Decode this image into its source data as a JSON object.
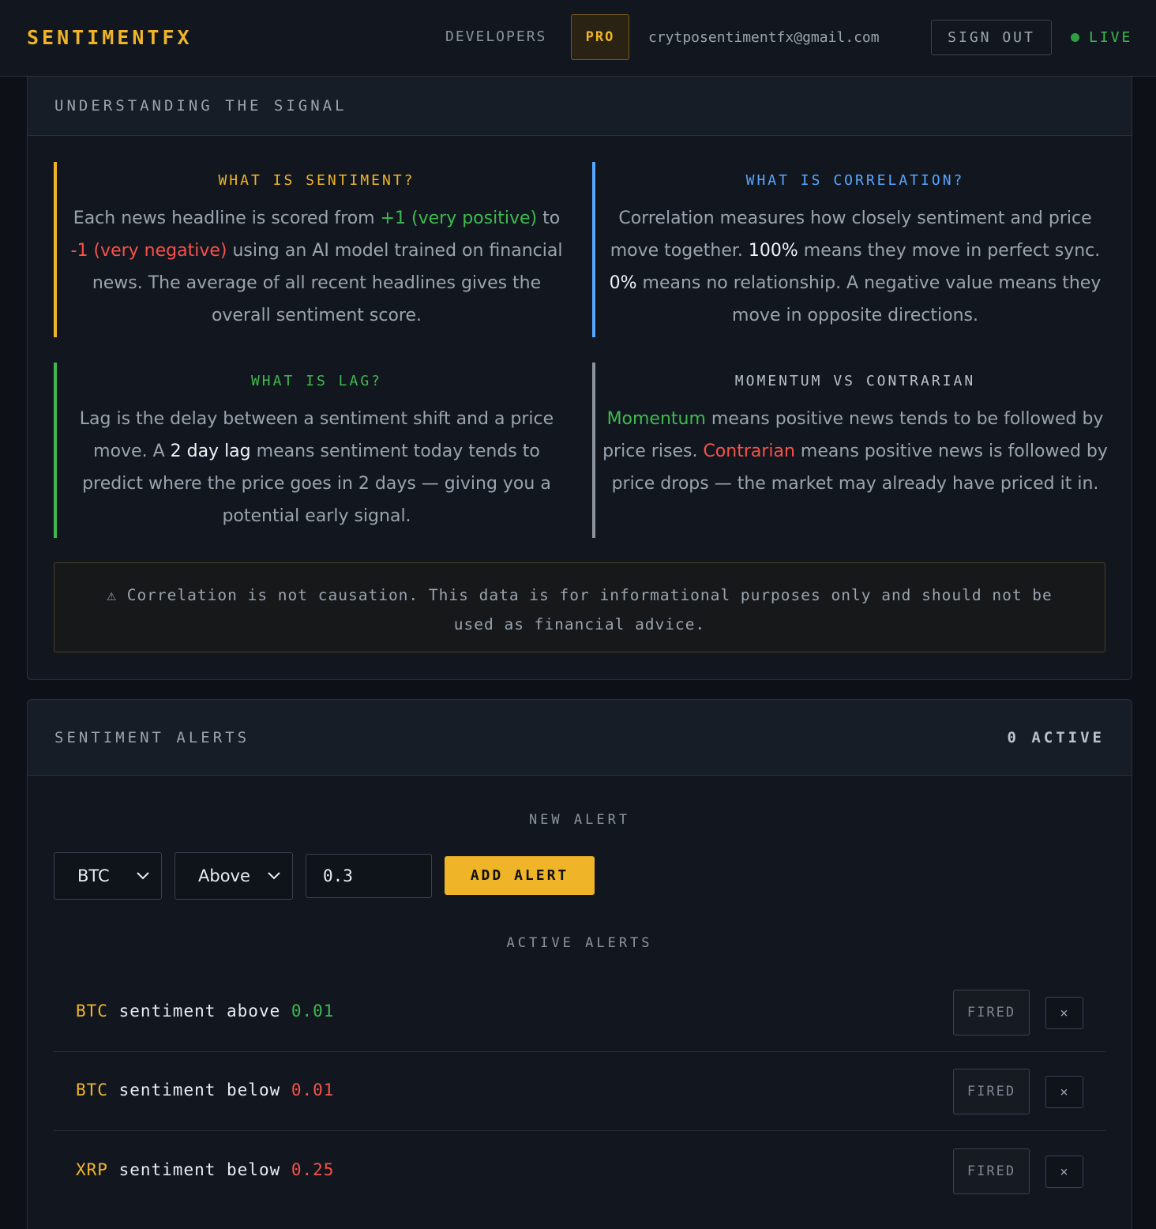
{
  "header": {
    "brand": "SENTIMENTFX",
    "developers": "DEVELOPERS",
    "pro": "PRO",
    "email": "crytposentimentfx@gmail.com",
    "sign_out": "SIGN OUT",
    "live": "LIVE",
    "live_color": "#3fb950"
  },
  "signal": {
    "title": "UNDERSTANDING THE SIGNAL",
    "sentiment": {
      "heading": "WHAT IS SENTIMENT?",
      "t1": "Each news headline is scored from ",
      "pos": "+1 (very positive)",
      "t2": " to ",
      "neg": "-1 (very negative)",
      "t3": " using an AI model trained on financial news. The average of all recent headlines gives the overall sentiment score.",
      "accent": "#f0b429"
    },
    "correlation": {
      "heading": "WHAT IS CORRELATION?",
      "t1": "Correlation measures how closely sentiment and price move together. ",
      "v1": "100%",
      "t2": " means they move in perfect sync. ",
      "v2": "0%",
      "t3": " means no relationship. A negative value means they move in opposite directions.",
      "accent": "#58a6ff"
    },
    "lag": {
      "heading": "WHAT IS LAG?",
      "t1": "Lag is the delay between a sentiment shift and a price move. A ",
      "v1": "2 day lag",
      "t2": " means sentiment today tends to predict where the price goes in 2 days — giving you a potential early signal.",
      "accent": "#3fb950"
    },
    "momentum": {
      "heading": "MOMENTUM VS CONTRARIAN",
      "m": "Momentum",
      "t1": " means positive news tends to be followed by price rises. ",
      "c": "Contrarian",
      "t2": " means positive news is followed by price drops — the market may already have priced it in.",
      "accent": "#8b949e"
    },
    "disclaimer": "⚠ Correlation is not causation. This data is for informational purposes only and should not be used as financial advice."
  },
  "alerts": {
    "title": "SENTIMENT ALERTS",
    "active_count": "0 ACTIVE",
    "new_alert": "NEW ALERT",
    "coin_select": "BTC",
    "direction_select": "Above",
    "threshold_value": "0.3",
    "add_button": "ADD ALERT",
    "active_heading": "ACTIVE ALERTS",
    "rows": [
      {
        "coin": "BTC",
        "text": " sentiment above ",
        "value": "0.01",
        "status": "FIRED",
        "remove": "×"
      },
      {
        "coin": "BTC",
        "text": " sentiment below ",
        "value": "0.01",
        "status": "FIRED",
        "remove": "×"
      },
      {
        "coin": "XRP",
        "text": " sentiment below ",
        "value": "0.25",
        "status": "FIRED",
        "remove": "×"
      }
    ]
  }
}
